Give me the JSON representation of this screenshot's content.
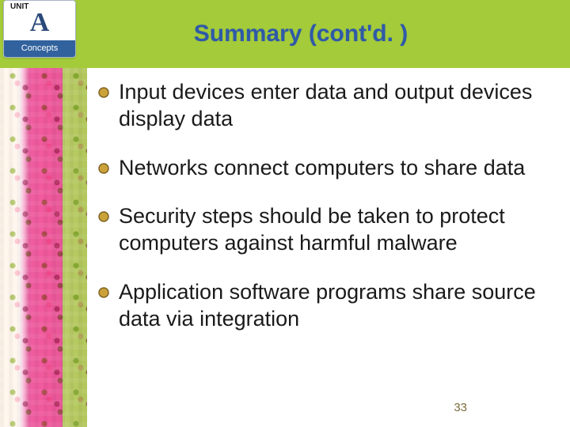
{
  "unit": {
    "label": "UNIT",
    "letter": "A",
    "subtitle": "Concepts"
  },
  "title": "Summary (cont'd. )",
  "bullets": [
    "Input devices enter data and output devices display data",
    "Networks connect computers to share data",
    "Security steps should be taken to protect computers against harmful malware",
    "Application software programs share source data via integration"
  ],
  "page_number": "33",
  "colors": {
    "header": "#a4cb3a",
    "title": "#2f5aa8",
    "bullet_fill": "#cba23a",
    "bullet_stroke": "#7a6020"
  }
}
